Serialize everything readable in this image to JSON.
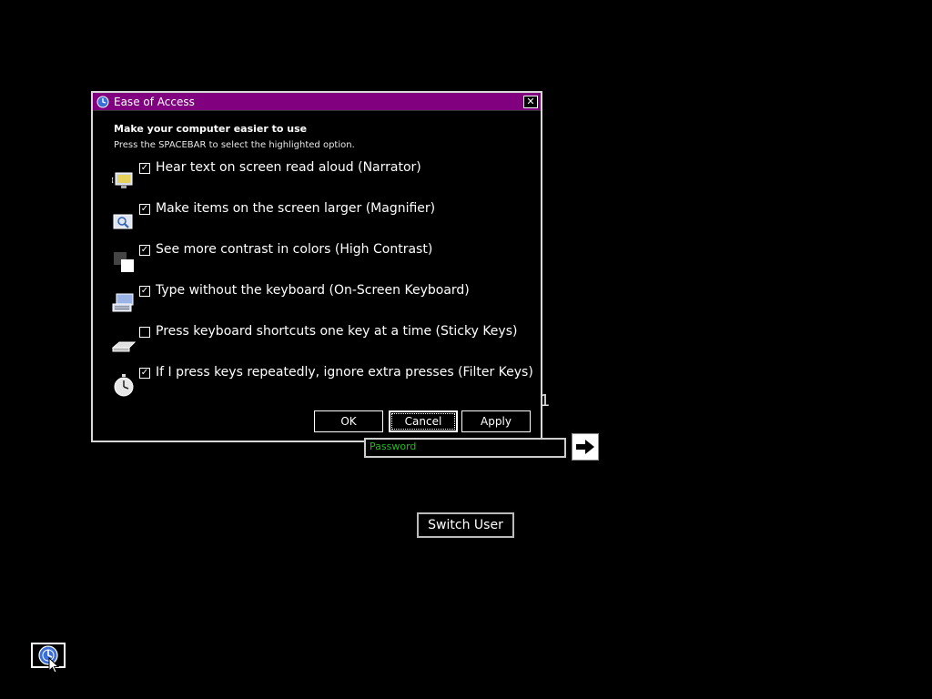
{
  "dialog": {
    "title": "Ease of Access",
    "close_glyph": "✕",
    "heading": "Make your computer easier to use",
    "subheading": "Press the SPACEBAR to select the highlighted option.",
    "options": [
      {
        "label": "Hear text on screen read aloud (Narrator)",
        "checked": true,
        "icon": "narrator-icon"
      },
      {
        "label": "Make items on the screen larger (Magnifier)",
        "checked": true,
        "icon": "magnifier-icon"
      },
      {
        "label": "See more contrast in colors (High Contrast)",
        "checked": true,
        "icon": "high-contrast-icon"
      },
      {
        "label": "Type without the keyboard (On-Screen Keyboard)",
        "checked": true,
        "icon": "on-screen-keyboard-icon"
      },
      {
        "label": "Press keyboard shortcuts one key at a time (Sticky Keys)",
        "checked": false,
        "icon": "sticky-keys-icon"
      },
      {
        "label": "If I press keys repeatedly, ignore extra presses (Filter Keys)",
        "checked": true,
        "icon": "filter-keys-icon"
      }
    ],
    "buttons": {
      "ok": "OK",
      "cancel": "Cancel",
      "apply": "Apply"
    }
  },
  "login": {
    "password_placeholder": "Password",
    "stray_char": "1",
    "switch_user": "Switch User"
  },
  "colors": {
    "titlebar": "#800080",
    "password_text": "#1ec01e",
    "background": "#000000"
  }
}
